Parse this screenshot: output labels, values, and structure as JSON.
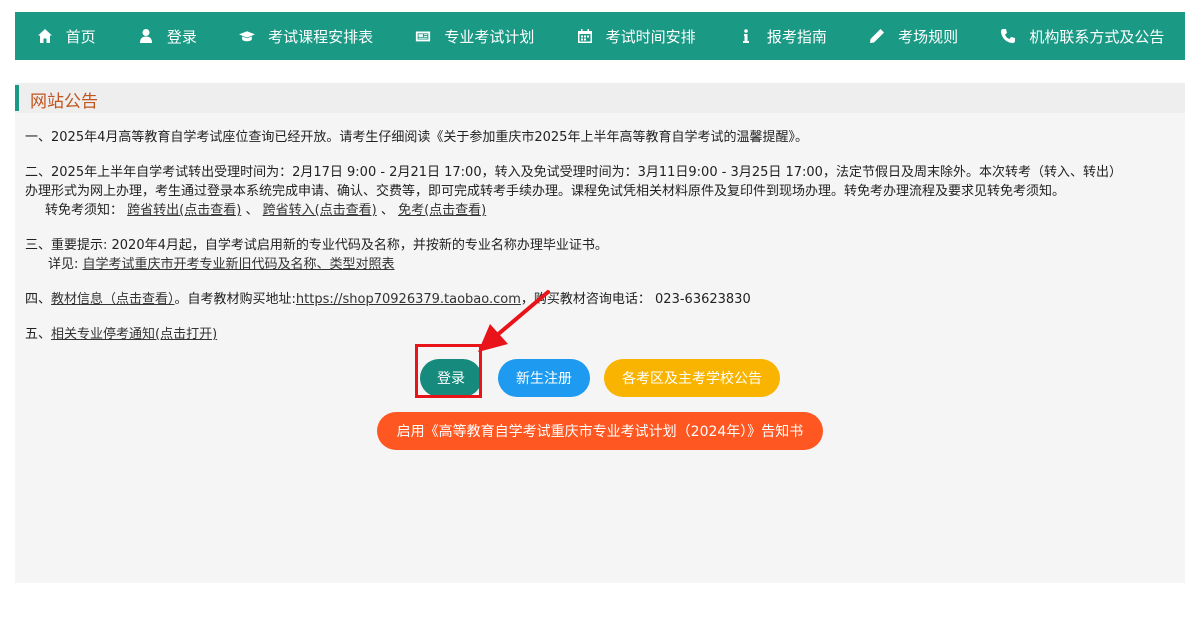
{
  "nav": {
    "items": [
      {
        "label": "首页",
        "icon": "home-icon"
      },
      {
        "label": "登录",
        "icon": "user-icon"
      },
      {
        "label": "考试课程安排表",
        "icon": "graduation-cap-icon"
      },
      {
        "label": "专业考试计划",
        "icon": "newspaper-icon"
      },
      {
        "label": "考试时间安排",
        "icon": "calendar-icon"
      },
      {
        "label": "报考指南",
        "icon": "info-icon"
      },
      {
        "label": "考场规则",
        "icon": "pencil-icon"
      },
      {
        "label": "机构联系方式及公告",
        "icon": "phone-icon"
      }
    ]
  },
  "panel": {
    "title": "网站公告"
  },
  "notices": {
    "n1": "一、2025年4月高等教育自学考试座位查询已经开放。请考生仔细阅读《关于参加重庆市2025年上半年高等教育自学考试的温馨提醒》。",
    "n2a": "二、2025年上半年自学考试转出受理时间为：2月17日 9:00 - 2月21日 17:00，转入及免试受理时间为：3月11日9:00 - 3月25日 17:00，法定节假日及周末除外。本次转考（转入、转出）",
    "n2b": "办理形式为网上办理，考生通过登录本系统完成申请、确认、交费等，即可完成转考手续办理。课程免试凭相关材料原件及复印件到现场办理。转免考办理流程及要求见转免考须知。",
    "n2c_prefix": "转免考须知：",
    "n2c_link1": "跨省转出(点击查看)",
    "n2c_sep1": "、",
    "n2c_link2": "跨省转入(点击查看)",
    "n2c_sep2": "、",
    "n2c_link3": "免考(点击查看)",
    "n3a": "三、重要提示: 2020年4月起，自学考试启用新的专业代码及名称，并按新的专业名称办理毕业证书。",
    "n3b_prefix": "详见: ",
    "n3b_link": "自学考试重庆市开考专业新旧代码及名称、类型对照表",
    "n4_prefix": "四、",
    "n4_link1": "教材信息（点击查看）",
    "n4_mid": "。自考教材购买地址:",
    "n4_link2": "https://shop70926379.taobao.com",
    "n4_suffix": "，购买教材咨询电话： 023-63623830",
    "n5_prefix": "五、",
    "n5_link": "相关专业停考通知(点击打开)"
  },
  "buttons": {
    "login": "登录",
    "register": "新生注册",
    "exam_notice": "各考区及主考学校公告",
    "plan": "启用《高等教育自学考试重庆市专业考试计划（2024年）》告知书"
  },
  "colors": {
    "nav_bg": "#1a9a85",
    "title_color": "#c0551f",
    "login_btn": "#168a7c",
    "register_btn": "#1e9bf0",
    "notice_btn": "#f8b400",
    "plan_btn": "#ff5722",
    "annotation_red": "#e8141a"
  }
}
